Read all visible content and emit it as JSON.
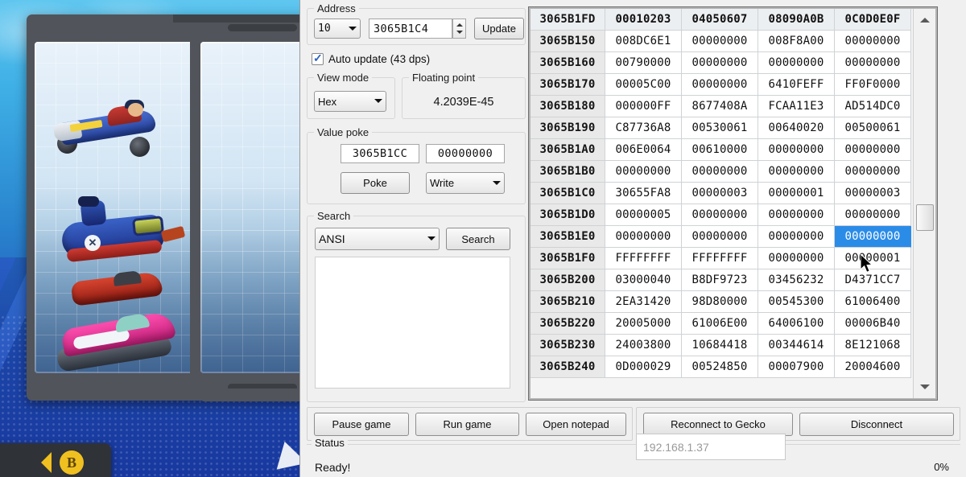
{
  "game": {
    "description": "Mario Kart 8 kart part selection screen",
    "back_button": {
      "arrow": "left-arrow-icon",
      "button_label": "B"
    }
  },
  "app": {
    "address_group": {
      "title": "Address",
      "radix_value": "10",
      "address_value": "3065B1C4",
      "update_label": "Update"
    },
    "auto_update": {
      "label": "Auto update (43 dps)",
      "checked": true
    },
    "view_mode": {
      "title": "View mode",
      "value": "Hex"
    },
    "floating_point": {
      "title": "Floating point",
      "value": "4.2039E-45"
    },
    "value_poke": {
      "title": "Value poke",
      "address_value": "3065B1CC",
      "data_value": "00000000",
      "poke_label": "Poke",
      "mode_value": "Write"
    },
    "search": {
      "title": "Search",
      "encoding_value": "ANSI",
      "search_label": "Search",
      "results": []
    },
    "buttons": {
      "pause_game": "Pause game",
      "run_game": "Run game",
      "open_notepad": "Open notepad",
      "reconnect": "Reconnect to Gecko",
      "disconnect": "Disconnect"
    },
    "ip_field": {
      "value": "192.168.1.37"
    },
    "status": {
      "title": "Status",
      "text": "Ready!",
      "percent": "0%"
    },
    "selection": {
      "color": "#2b8ce8",
      "row": 9,
      "column": 4
    },
    "memory_table": {
      "header_row": {
        "address": "3065B1FD",
        "values": [
          "00010203",
          "04050607",
          "08090A0B",
          "0C0D0E0F"
        ]
      },
      "rows": [
        {
          "address": "3065B150",
          "values": [
            "008DC6E1",
            "00000000",
            "008F8A00",
            "00000000"
          ]
        },
        {
          "address": "3065B160",
          "values": [
            "00790000",
            "00000000",
            "00000000",
            "00000000"
          ]
        },
        {
          "address": "3065B170",
          "values": [
            "00005C00",
            "00000000",
            "6410FEFF",
            "FF0F0000"
          ]
        },
        {
          "address": "3065B180",
          "values": [
            "000000FF",
            "8677408A",
            "FCAA11E3",
            "AD514DC0"
          ]
        },
        {
          "address": "3065B190",
          "values": [
            "C87736A8",
            "00530061",
            "00640020",
            "00500061"
          ]
        },
        {
          "address": "3065B1A0",
          "values": [
            "006E0064",
            "00610000",
            "00000000",
            "00000000"
          ]
        },
        {
          "address": "3065B1B0",
          "values": [
            "00000000",
            "00000000",
            "00000000",
            "00000000"
          ]
        },
        {
          "address": "3065B1C0",
          "values": [
            "30655FA8",
            "00000003",
            "00000001",
            "00000003"
          ]
        },
        {
          "address": "3065B1D0",
          "values": [
            "00000005",
            "00000000",
            "00000000",
            "00000000"
          ]
        },
        {
          "address": "3065B1E0",
          "values": [
            "00000000",
            "00000000",
            "00000000",
            "00000000"
          ]
        },
        {
          "address": "3065B1F0",
          "values": [
            "FFFFFFFF",
            "FFFFFFFF",
            "00000000",
            "00000001"
          ]
        },
        {
          "address": "3065B200",
          "values": [
            "03000040",
            "B8DF9723",
            "03456232",
            "D4371CC7"
          ]
        },
        {
          "address": "3065B210",
          "values": [
            "2EA31420",
            "98D80000",
            "00545300",
            "61006400"
          ]
        },
        {
          "address": "3065B220",
          "values": [
            "20005000",
            "61006E00",
            "64006100",
            "00006B40"
          ]
        },
        {
          "address": "3065B230",
          "values": [
            "24003800",
            "10684418",
            "00344614",
            "8E121068"
          ]
        },
        {
          "address": "3065B240",
          "values": [
            "0D000029",
            "00524850",
            "00007900",
            "20004600"
          ]
        }
      ]
    }
  }
}
